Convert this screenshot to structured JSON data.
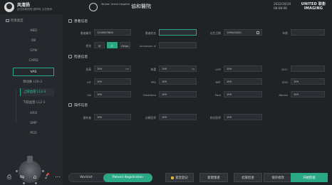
{
  "user": {
    "name": "风清扬",
    "subtitle": "武汉协和医院  超声科  主任医师"
  },
  "hospital": {
    "name_en": "Wuhan Union Hospital",
    "name_cn": "協和醫院"
  },
  "clock": {
    "date": "2022/10/10",
    "time": "08:08:08"
  },
  "brand": {
    "line1": "UNITED 联影",
    "line2": "IMAGING"
  },
  "sidebar": {
    "title": "检查类型",
    "items": [
      {
        "label": "ABD"
      },
      {
        "label": "OB"
      },
      {
        "label": "GYN"
      },
      {
        "label": "CARD"
      },
      {
        "label": "VAS"
      },
      {
        "label": "URO"
      },
      {
        "label": "SMP"
      },
      {
        "label": "PED"
      }
    ],
    "sub_items": [
      {
        "label": "颈动脉 L10-3"
      },
      {
        "label": "上肢血管 L12-3"
      },
      {
        "label": "下肢血管 L12-3"
      }
    ],
    "active_item": "VAS",
    "active_sub_item": "上肢血管 L12-3"
  },
  "patient_info": {
    "title": "患者信息",
    "patient_id_label": "患者编号",
    "patient_id_value": "1234567890",
    "patient_name_label": "患者姓名",
    "patient_name_value": "",
    "birth_date_label": "出生日期",
    "birth_date_value": "1990/00/00",
    "age_label": "年龄",
    "age_value": "",
    "gender_label": "性别",
    "gender_options": [
      "M",
      "F",
      "Other"
    ],
    "gender_selected": "F",
    "accession_label": "Accession #",
    "accession_value": ""
  },
  "exam_info": {
    "title": "检查信息",
    "height_label": "身高",
    "height_value": "199",
    "height_unit": "cm",
    "weight_label": "体重",
    "weight_value": "199",
    "weight_unit": "kg",
    "lmp_label": "LMP",
    "lmp_value": "199",
    "doc_label": "DOC",
    "doc_value": "",
    "ivf_label": "IVF",
    "ivf_value": "199",
    "prv_label": "PRV",
    "prv_value": "199",
    "bbt_label": "BBT",
    "bbt_value": "199",
    "edd_label": "EDD",
    "edd_value": "199",
    "ga_label": "GA",
    "ga_value": "199",
    "gestation_label": "Gestation",
    "gestation_value": "199",
    "para_label": "Para",
    "para_value": "199",
    "aborta_label": "Aborta",
    "aborta_value": "199"
  },
  "operator_info": {
    "title": "操作信息",
    "operator_label": "操作者",
    "operator_value": "199",
    "diagnostician_label": "诊断医师",
    "diagnostician_value": "199",
    "referring_label": "转诊医师",
    "referring_value": "199"
  },
  "bottom": {
    "tabs": [
      "Worklist",
      "Patient Registration"
    ],
    "selected_tab": "Patient Registration",
    "buttons": {
      "emergency": "紧急登记",
      "new_patient": "新建患者",
      "end_exam": "结束检查",
      "save": "保存修改",
      "start": "开始检查"
    }
  },
  "colors": {
    "accent": "#2aa784",
    "background": "#202326",
    "sidebar": "#25282c"
  }
}
